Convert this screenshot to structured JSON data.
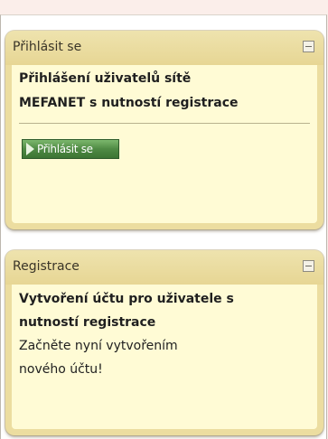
{
  "login_block": {
    "title": "Přihlásit se",
    "description_line1": "Přihlášení uživatelů sítě",
    "description_line2": "MEFANET s nutností registrace",
    "button_label": "Přihlásit se"
  },
  "register_block": {
    "title": "Registrace",
    "description_line1": "Vytvoření účtu pro uživatele s",
    "description_line2": "nutností registrace",
    "link_line1": "Začněte nyní vytvořením",
    "link_line2": "nového účtu!"
  },
  "colors": {
    "page_background": "#fbeeea",
    "block_frame": "#ecdda0",
    "block_body": "#fffbd5",
    "button_green": "#4f8a44"
  },
  "icons": {
    "collapse": "minus-box-icon",
    "button": "right-arrow-icon"
  }
}
